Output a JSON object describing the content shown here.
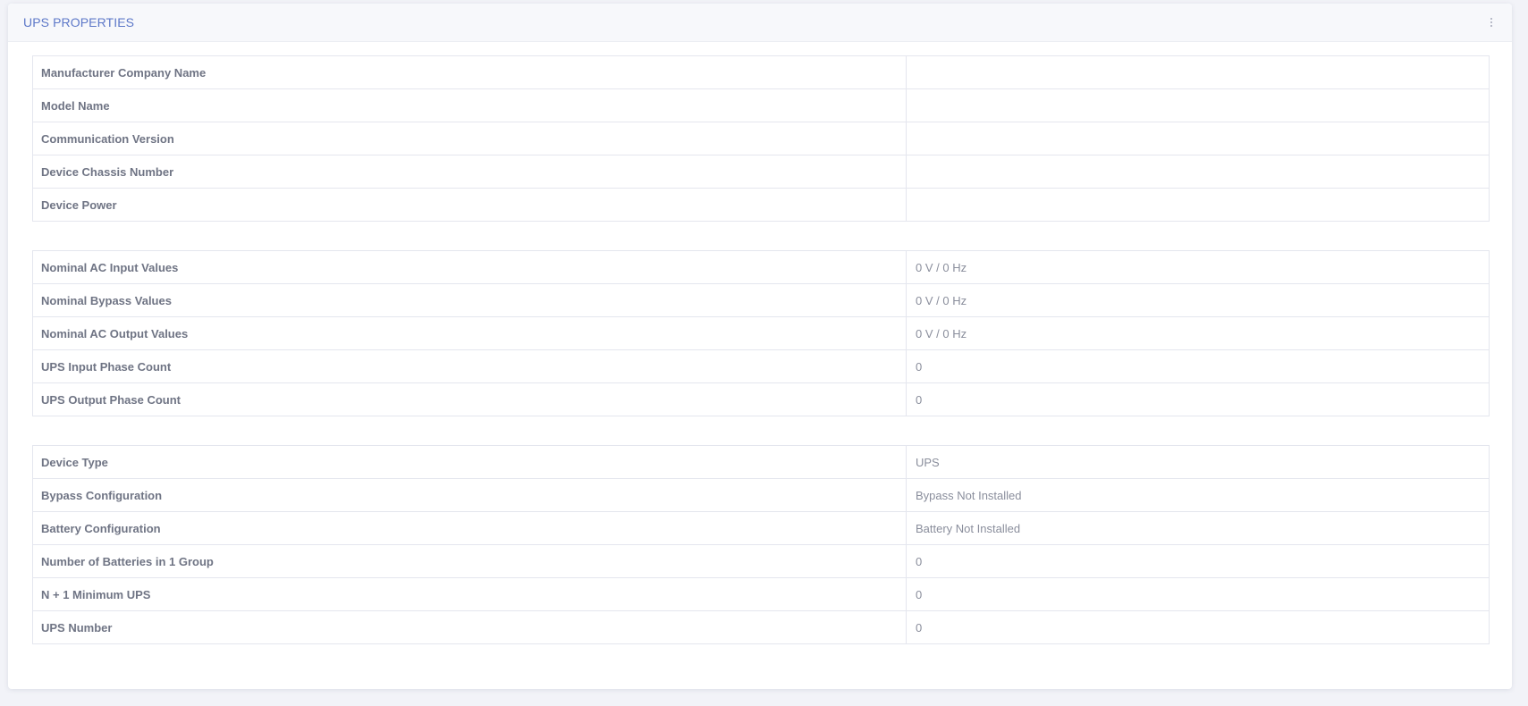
{
  "card": {
    "title": "UPS PROPERTIES"
  },
  "tables": [
    {
      "rows": [
        {
          "label": "Manufacturer Company Name",
          "value": ""
        },
        {
          "label": "Model Name",
          "value": ""
        },
        {
          "label": "Communication Version",
          "value": ""
        },
        {
          "label": "Device Chassis Number",
          "value": ""
        },
        {
          "label": "Device Power",
          "value": ""
        }
      ]
    },
    {
      "rows": [
        {
          "label": "Nominal AC Input Values",
          "value": "0 V / 0 Hz"
        },
        {
          "label": "Nominal Bypass Values",
          "value": "0 V / 0 Hz"
        },
        {
          "label": "Nominal AC Output Values",
          "value": "0 V / 0 Hz"
        },
        {
          "label": "UPS Input Phase Count",
          "value": "0"
        },
        {
          "label": "UPS Output Phase Count",
          "value": "0"
        }
      ]
    },
    {
      "rows": [
        {
          "label": "Device Type",
          "value": "UPS"
        },
        {
          "label": "Bypass Configuration",
          "value": "Bypass Not Installed"
        },
        {
          "label": "Battery Configuration",
          "value": "Battery Not Installed"
        },
        {
          "label": "Number of Batteries in 1 Group",
          "value": "0"
        },
        {
          "label": "N + 1 Minimum UPS",
          "value": "0"
        },
        {
          "label": "UPS Number",
          "value": "0"
        }
      ]
    }
  ],
  "icons": {
    "menu": "more-vertical-icon"
  },
  "colors": {
    "title": "#5d78c8",
    "background": "#f2f3f8",
    "border": "#e4e6ee"
  }
}
